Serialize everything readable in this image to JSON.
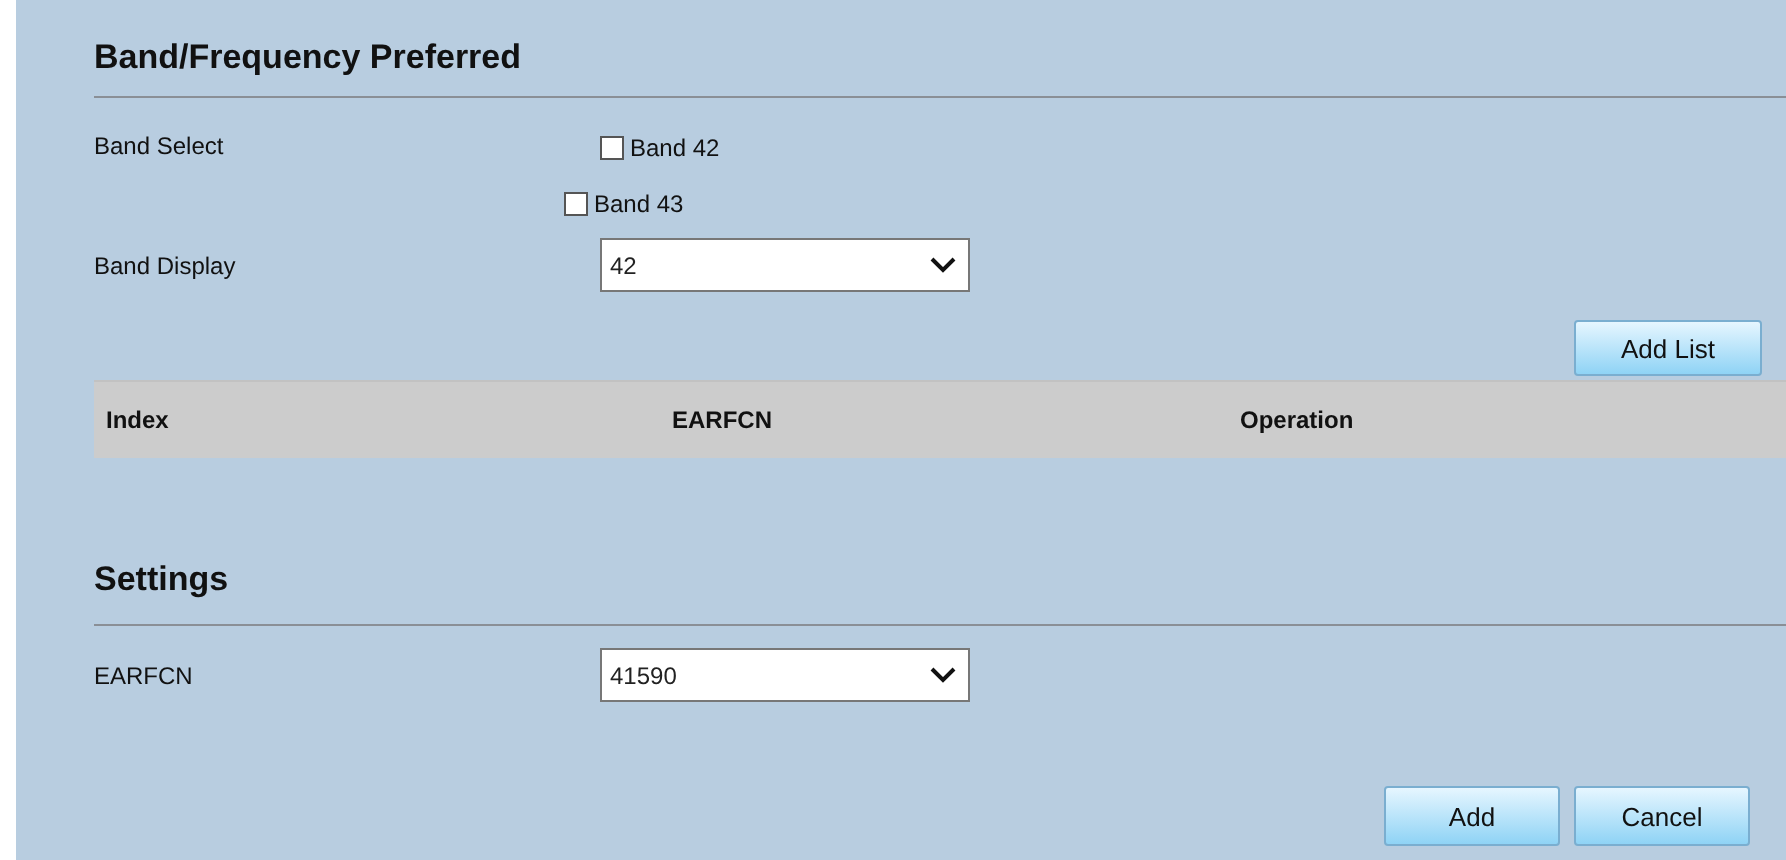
{
  "band_section": {
    "title": "Band/Frequency Preferred",
    "band_select": {
      "label": "Band Select",
      "options": [
        {
          "label": "Band 42",
          "checked": false
        },
        {
          "label": "Band 43",
          "checked": false
        }
      ]
    },
    "band_display": {
      "label": "Band Display",
      "value": "42"
    },
    "add_list_button": "Add List",
    "table": {
      "columns": [
        "Index",
        "EARFCN",
        "Operation"
      ]
    }
  },
  "settings_section": {
    "title": "Settings",
    "earfcn": {
      "label": "EARFCN",
      "value": "41590"
    }
  },
  "buttons": [
    "Add",
    "Cancel"
  ]
}
